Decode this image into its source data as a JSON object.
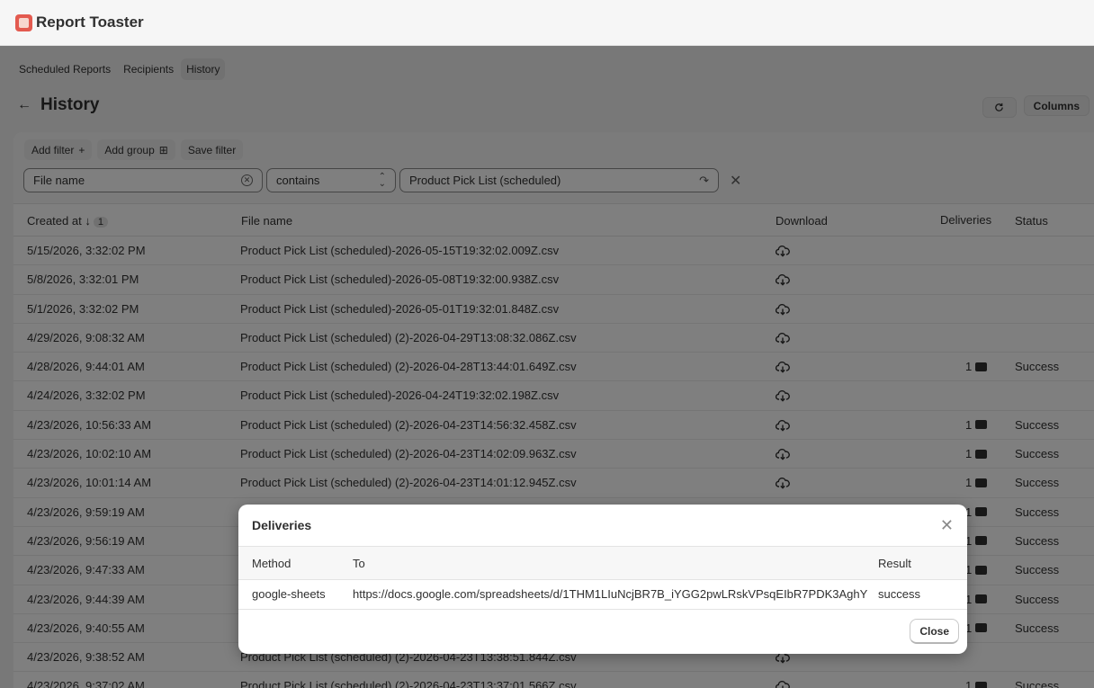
{
  "app": {
    "title": "Report Toaster"
  },
  "tabs": [
    {
      "label": "Scheduled Reports",
      "active": false
    },
    {
      "label": "Recipients",
      "active": false
    },
    {
      "label": "History",
      "active": true
    }
  ],
  "page": {
    "title": "History",
    "columns_label": "Columns"
  },
  "filter": {
    "add_filter": "Add filter",
    "add_group": "Add group",
    "save_filter": "Save filter",
    "field": "File name",
    "operator": "contains",
    "value": "Product Pick List (scheduled)"
  },
  "table": {
    "headers": {
      "created_at": "Created at",
      "sort_badge": "1",
      "file_name": "File name",
      "download": "Download",
      "deliveries": "Deliveries",
      "status": "Status"
    },
    "rows": [
      {
        "created_at": "5/15/2026, 3:32:02 PM",
        "file_name": "Product Pick List (scheduled)-2026-05-15T19:32:02.009Z.csv",
        "deliveries": "",
        "status": ""
      },
      {
        "created_at": "5/8/2026, 3:32:01 PM",
        "file_name": "Product Pick List (scheduled)-2026-05-08T19:32:00.938Z.csv",
        "deliveries": "",
        "status": ""
      },
      {
        "created_at": "5/1/2026, 3:32:02 PM",
        "file_name": "Product Pick List (scheduled)-2026-05-01T19:32:01.848Z.csv",
        "deliveries": "",
        "status": ""
      },
      {
        "created_at": "4/29/2026, 9:08:32 AM",
        "file_name": "Product Pick List (scheduled) (2)-2026-04-29T13:08:32.086Z.csv",
        "deliveries": "",
        "status": ""
      },
      {
        "created_at": "4/28/2026, 9:44:01 AM",
        "file_name": "Product Pick List (scheduled) (2)-2026-04-28T13:44:01.649Z.csv",
        "deliveries": "1",
        "status": "Success"
      },
      {
        "created_at": "4/24/2026, 3:32:02 PM",
        "file_name": "Product Pick List (scheduled)-2026-04-24T19:32:02.198Z.csv",
        "deliveries": "",
        "status": ""
      },
      {
        "created_at": "4/23/2026, 10:56:33 AM",
        "file_name": "Product Pick List (scheduled) (2)-2026-04-23T14:56:32.458Z.csv",
        "deliveries": "1",
        "status": "Success"
      },
      {
        "created_at": "4/23/2026, 10:02:10 AM",
        "file_name": "Product Pick List (scheduled) (2)-2026-04-23T14:02:09.963Z.csv",
        "deliveries": "1",
        "status": "Success"
      },
      {
        "created_at": "4/23/2026, 10:01:14 AM",
        "file_name": "Product Pick List (scheduled) (2)-2026-04-23T14:01:12.945Z.csv",
        "deliveries": "1",
        "status": "Success"
      },
      {
        "created_at": "4/23/2026, 9:59:19 AM",
        "file_name": "",
        "deliveries": "1",
        "status": "Success"
      },
      {
        "created_at": "4/23/2026, 9:56:19 AM",
        "file_name": "",
        "deliveries": "1",
        "status": "Success"
      },
      {
        "created_at": "4/23/2026, 9:47:33 AM",
        "file_name": "",
        "deliveries": "1",
        "status": "Success"
      },
      {
        "created_at": "4/23/2026, 9:44:39 AM",
        "file_name": "",
        "deliveries": "1",
        "status": "Success"
      },
      {
        "created_at": "4/23/2026, 9:40:55 AM",
        "file_name": "",
        "deliveries": "1",
        "status": "Success"
      },
      {
        "created_at": "4/23/2026, 9:38:52 AM",
        "file_name": "Product Pick List (scheduled) (2)-2026-04-23T13:38:51.844Z.csv",
        "deliveries": "",
        "status": ""
      },
      {
        "created_at": "4/23/2026, 9:37:02 AM",
        "file_name": "Product Pick List (scheduled) (2)-2026-04-23T13:37:01.566Z.csv",
        "deliveries": "1",
        "status": "Success"
      }
    ]
  },
  "modal": {
    "title": "Deliveries",
    "headers": {
      "method": "Method",
      "to": "To",
      "result": "Result"
    },
    "rows": [
      {
        "method": "google-sheets",
        "to": "https://docs.google.com/spreadsheets/d/1THM1LIuNcjBR7B_iYGG2pwLRskVPsqEIbR7PDK3AghY",
        "result": "success"
      }
    ],
    "close_label": "Close"
  },
  "icons": {
    "download": "cloud-download-icon",
    "deliveries": "message-icon",
    "refresh": "refresh-icon",
    "back": "arrow-left-icon",
    "close": "close-icon"
  }
}
